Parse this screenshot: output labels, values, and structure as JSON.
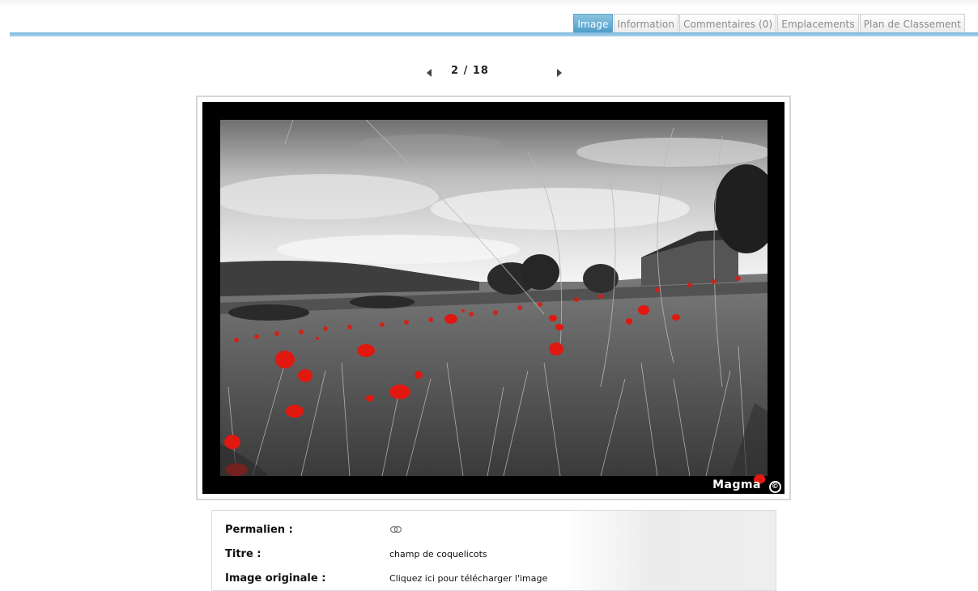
{
  "tabs": [
    {
      "label": "Image",
      "active": true
    },
    {
      "label": "Information",
      "active": false
    },
    {
      "label": "Commentaires (0)",
      "active": false
    },
    {
      "label": "Emplacements",
      "active": false
    },
    {
      "label": "Plan de Classement",
      "active": false
    }
  ],
  "pager": {
    "current": "2 / 18"
  },
  "photo": {
    "watermark": "Magma",
    "copyright_symbol": "©"
  },
  "info": {
    "permalink_label": "Permalien :",
    "permalink_icon": "chain-link-icon",
    "title_label": "Titre :",
    "title_value": "champ de coquelicots",
    "original_label": "Image originale :",
    "original_value": "Cliquez ici pour télécharger l'image"
  },
  "colors": {
    "tab_active": "#5aa8d2",
    "tab_line": "#8cc4e4",
    "poppy": "#e0180f"
  }
}
